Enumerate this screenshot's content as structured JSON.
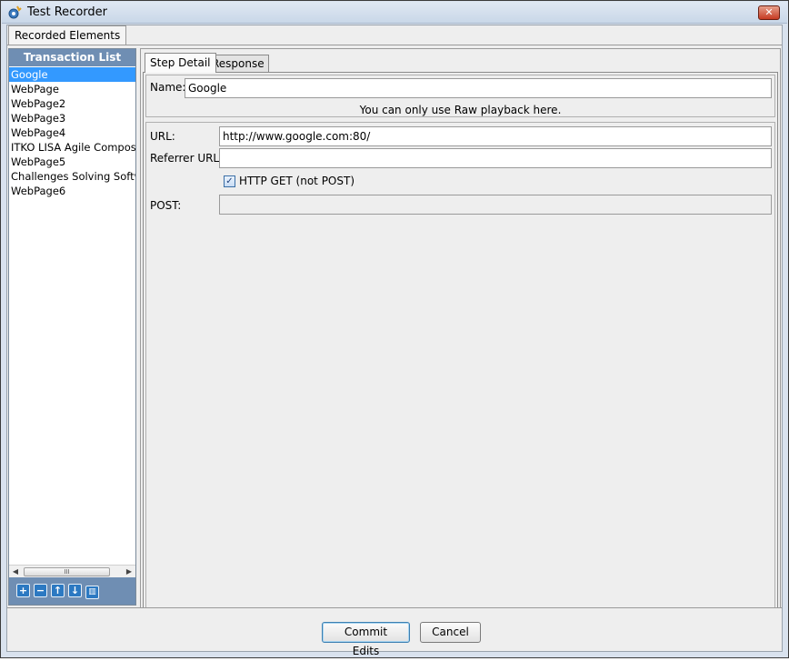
{
  "window": {
    "title": "Test Recorder",
    "close_glyph": "✕"
  },
  "outer_tab": {
    "label": "Recorded Elements"
  },
  "transaction_list": {
    "header": "Transaction List",
    "items": [
      {
        "label": "Google",
        "selected": true
      },
      {
        "label": "WebPage",
        "selected": false
      },
      {
        "label": "WebPage2",
        "selected": false
      },
      {
        "label": "WebPage3",
        "selected": false
      },
      {
        "label": "WebPage4",
        "selected": false
      },
      {
        "label": "ITKO LISA  Agile Composite",
        "selected": false
      },
      {
        "label": "WebPage5",
        "selected": false
      },
      {
        "label": "Challenges Solving Software",
        "selected": false
      },
      {
        "label": "WebPage6",
        "selected": false
      }
    ],
    "scroll_thumb_glyph": "III",
    "toolbar": [
      {
        "icon": "add-icon",
        "glyph": "+"
      },
      {
        "icon": "remove-icon",
        "glyph": "−"
      },
      {
        "icon": "move-up-icon",
        "glyph": "↑"
      },
      {
        "icon": "move-down-icon",
        "glyph": "↓"
      },
      {
        "icon": "delete-icon",
        "glyph": "🗑"
      }
    ]
  },
  "tabs": {
    "step_detail": "Step Detail",
    "response": "Response"
  },
  "step": {
    "name_label": "Name:",
    "name_value": "Google",
    "note": "You can only use Raw playback here.",
    "url_label": "URL:",
    "url_value": "http://www.google.com:80/",
    "referrer_label": "Referrer URL:",
    "referrer_value": "",
    "http_get_label": "HTTP GET (not POST)",
    "http_get_checked": true,
    "post_label": "POST:",
    "post_value": ""
  },
  "buttons": {
    "commit": "Commit Edits",
    "cancel": "Cancel"
  }
}
